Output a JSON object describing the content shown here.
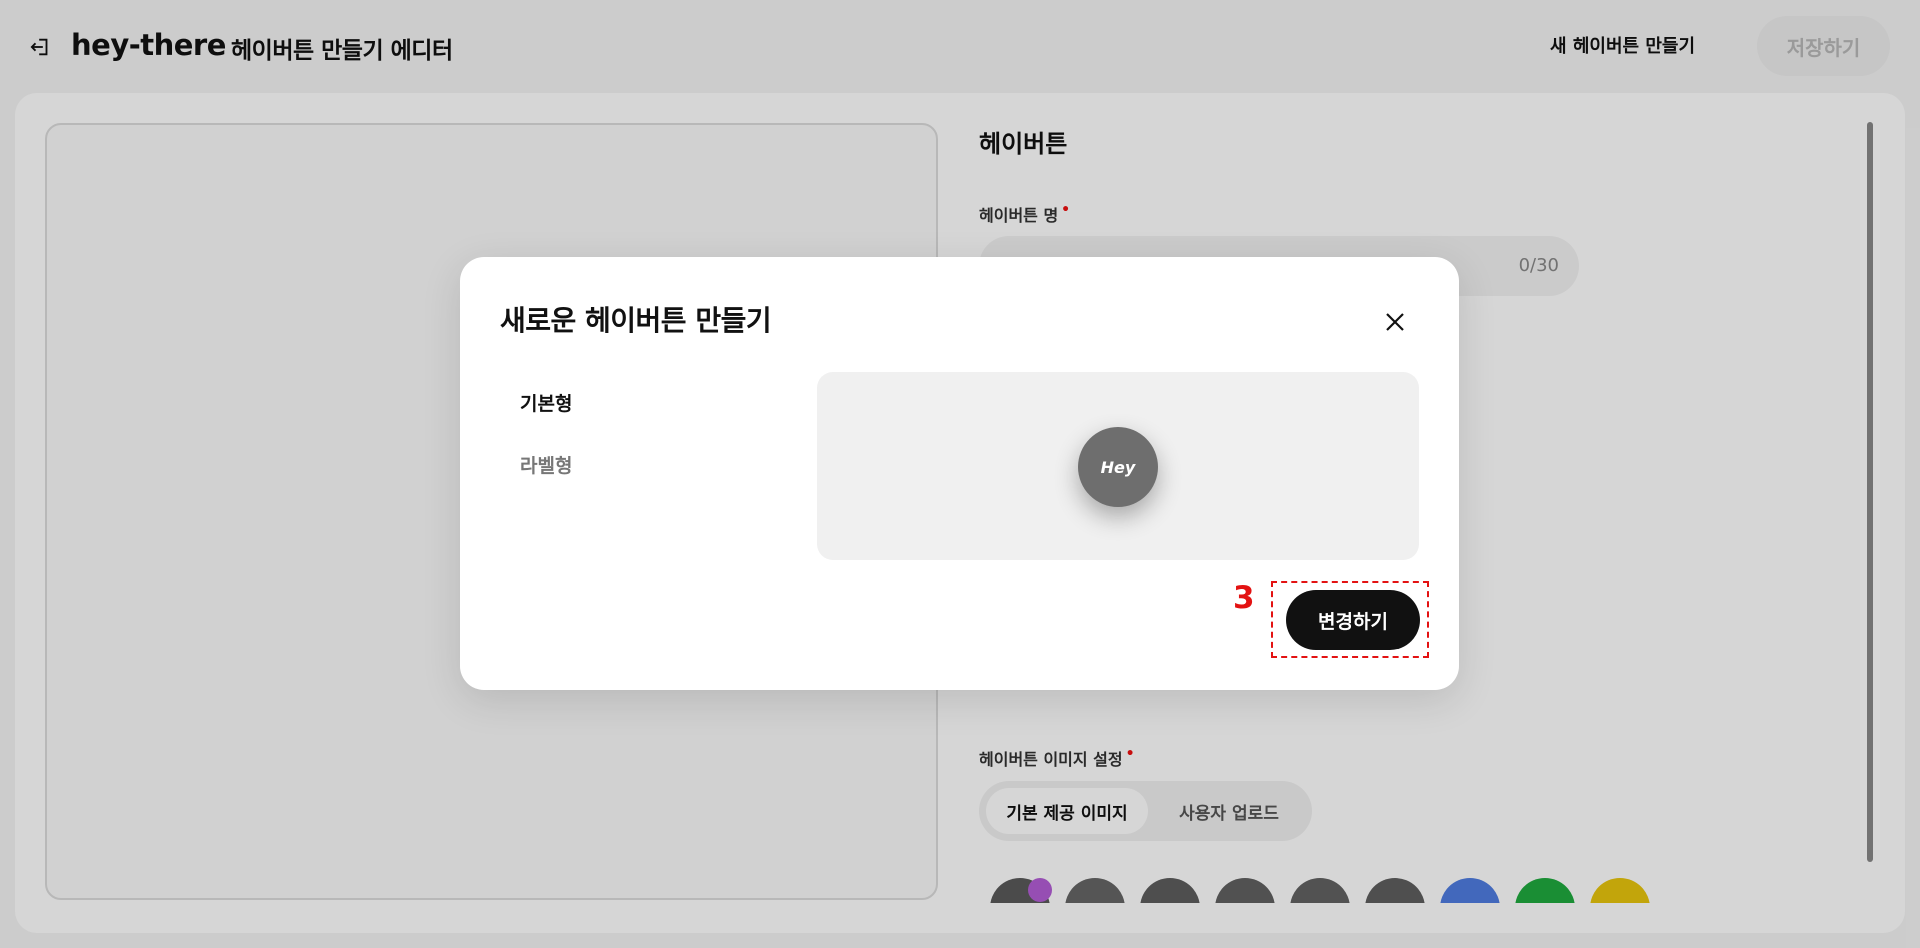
{
  "header": {
    "logo": "hey-there",
    "title": "헤이버튼 만들기 에디터",
    "new_button_label": "새 헤이버튼 만들기",
    "save_button_label": "저장하기"
  },
  "editor": {
    "section_title": "헤이버튼",
    "name_label": "헤이버튼 명",
    "required_mark": "•",
    "name_counter": "0/30",
    "image_setting_label": "헤이버튼 이미지 설정",
    "image_tabs": [
      "기본 제공 이미지",
      "사용자 업로드"
    ],
    "swatch_colors": [
      "#5a5a5a",
      "#666666",
      "#5e5e5e",
      "#616161",
      "#626262",
      "#5f5f5f",
      "#4f7de0",
      "#1faa3f",
      "#e8c50e"
    ]
  },
  "modal": {
    "title": "새로운 헤이버튼 만들기",
    "types": [
      "기본형",
      "라벨형"
    ],
    "selected_type": "기본형",
    "preview_text": "Hey",
    "change_button_label": "변경하기",
    "step_number": "3"
  },
  "colors": {
    "accent": "#111111",
    "annotation": "#e31212",
    "required": "#e11111"
  }
}
